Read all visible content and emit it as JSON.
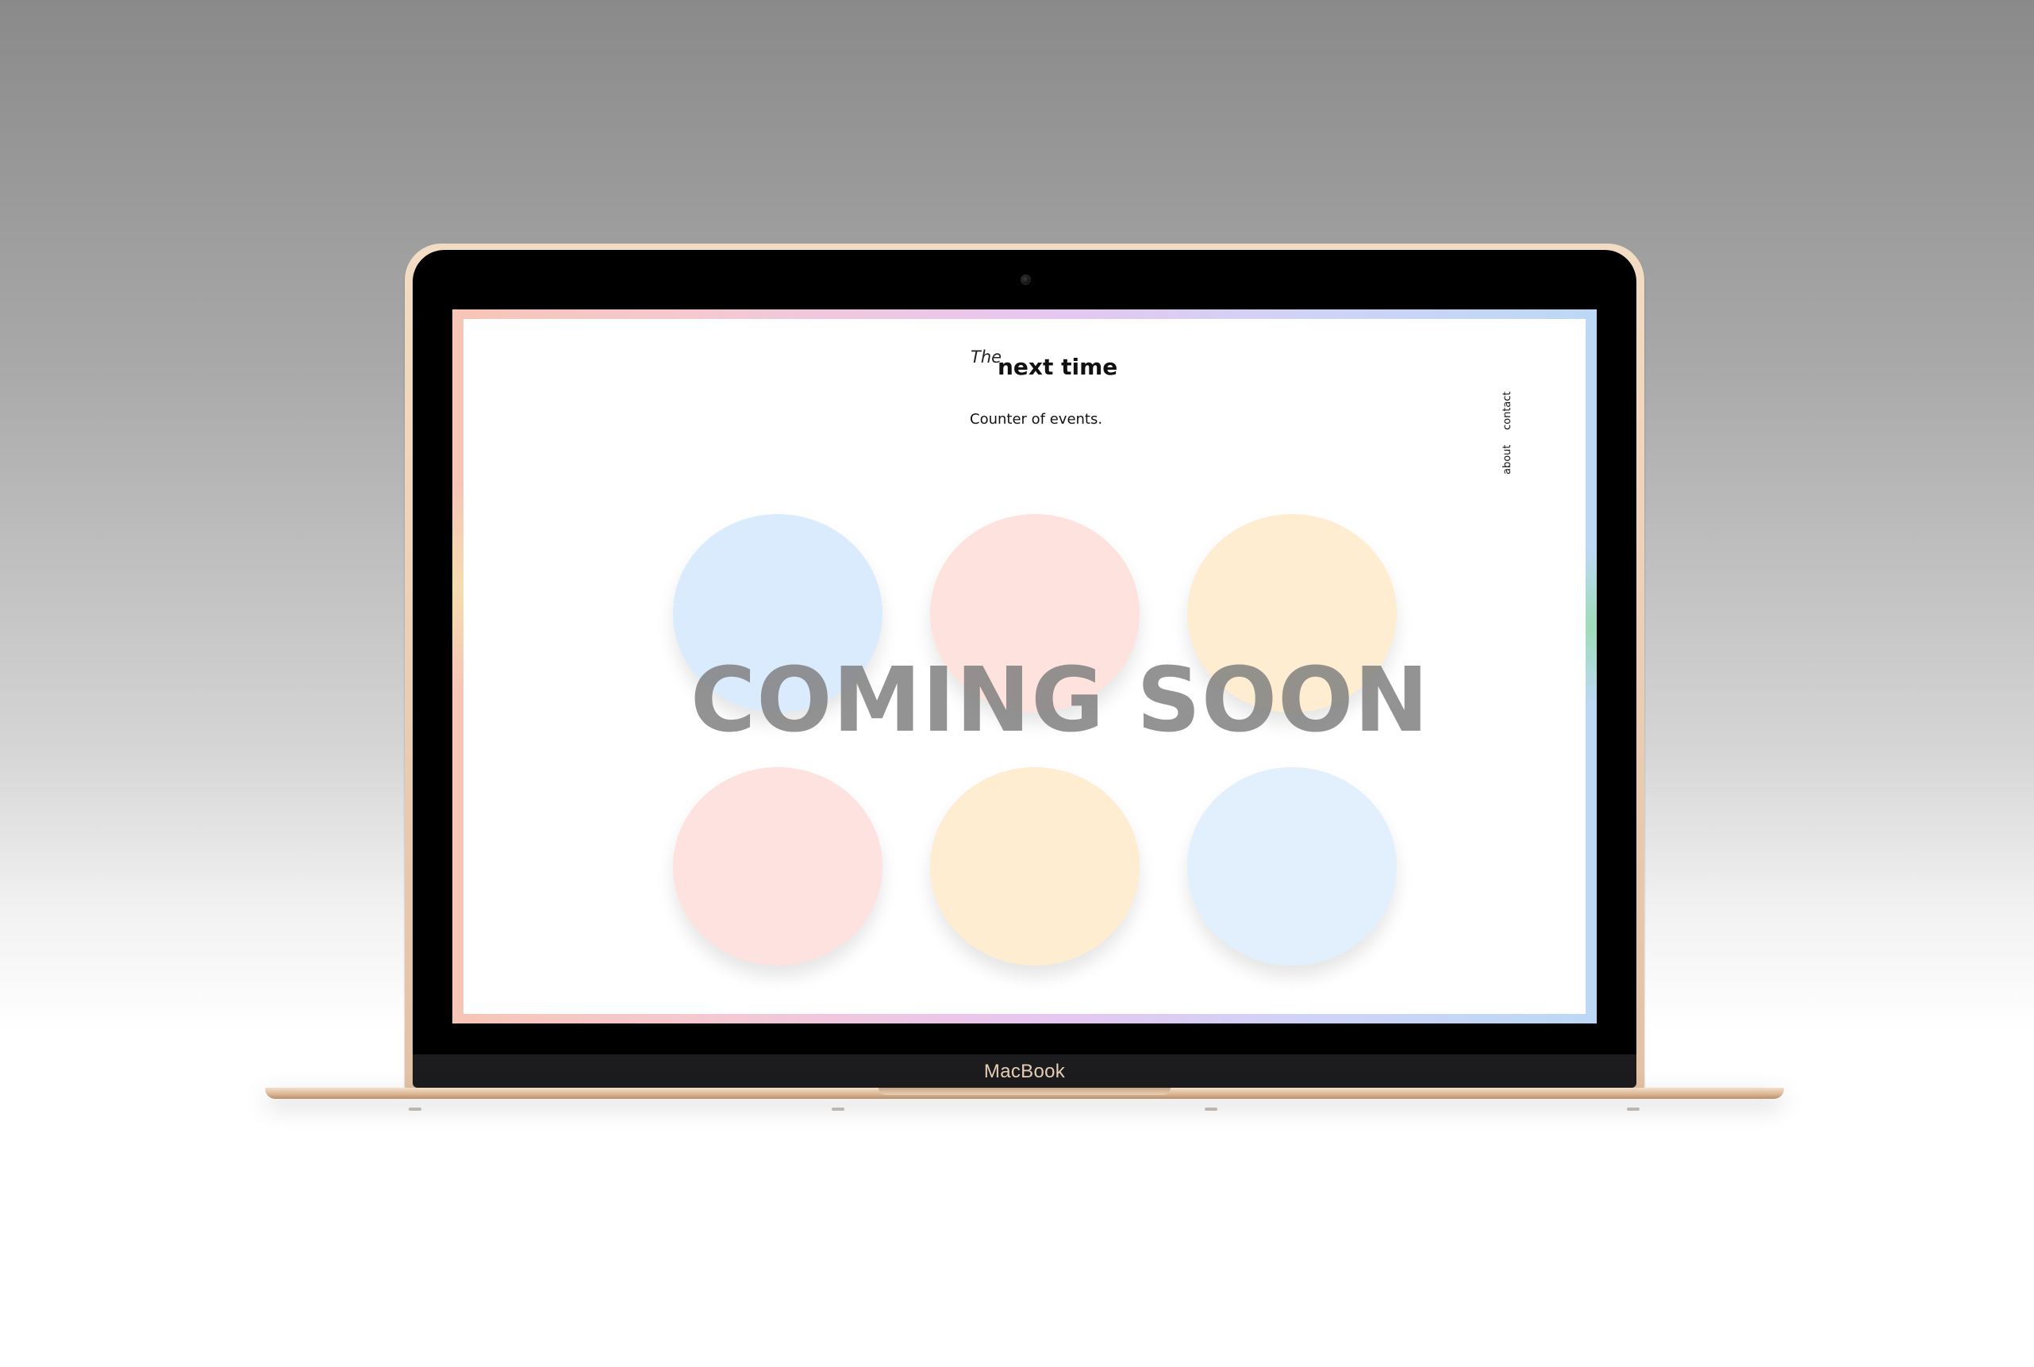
{
  "device": {
    "model_label": "MacBook"
  },
  "site": {
    "brand_prefix": "The",
    "brand_name": "next time",
    "tagline": "Counter of events.",
    "nav": {
      "about": "about",
      "contact": "contact"
    },
    "headline": "COMING SOON",
    "circles": [
      {
        "color": "#d9ebfd"
      },
      {
        "color": "#fee2de"
      },
      {
        "color": "#feedd0"
      },
      {
        "color": "#fee2df"
      },
      {
        "color": "#feedd0"
      },
      {
        "color": "#e2f0fd"
      }
    ]
  }
}
